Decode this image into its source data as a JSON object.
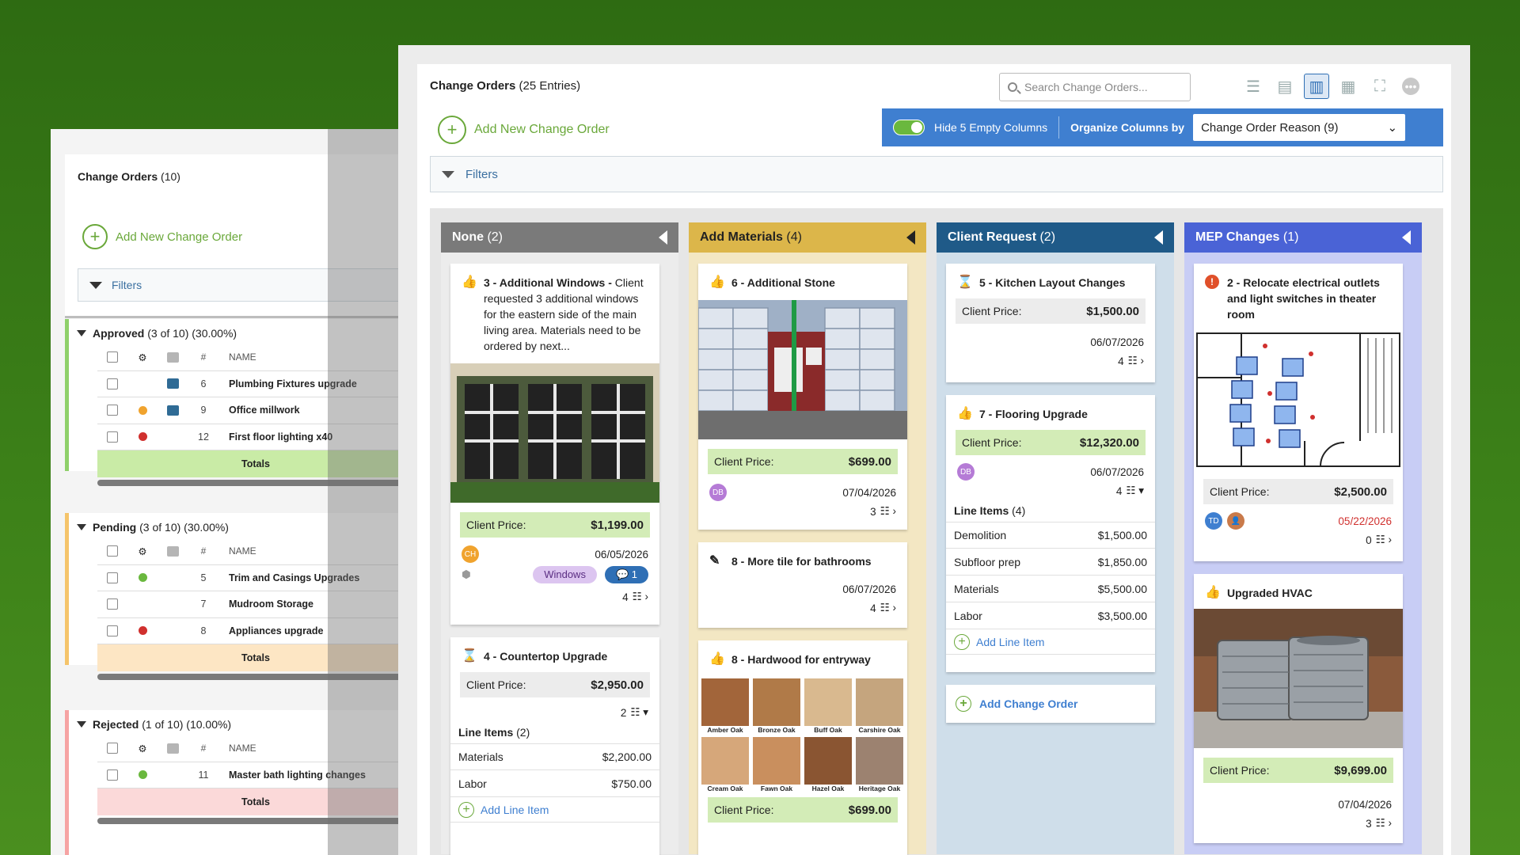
{
  "back": {
    "title": "Change Orders",
    "title_count": "(10)",
    "add_label": "Add New Change Order",
    "filters_label": "Filters",
    "col_hash": "#",
    "col_name": "NAME",
    "totals": "Totals",
    "groups": [
      {
        "name": "Approved",
        "stats": "(3 of 10) (30.00%)",
        "rows": [
          {
            "num": "6",
            "name": "Plumbing Fixtures upgrade"
          },
          {
            "num": "9",
            "name": "Office millwork"
          },
          {
            "num": "12",
            "name": "First floor lighting x40"
          }
        ]
      },
      {
        "name": "Pending",
        "stats": "(3 of 10) (30.00%)",
        "rows": [
          {
            "num": "5",
            "name": "Trim and Casings Upgrades"
          },
          {
            "num": "7",
            "name": "Mudroom Storage"
          },
          {
            "num": "8",
            "name": "Appliances upgrade"
          }
        ]
      },
      {
        "name": "Rejected",
        "stats": "(1 of 10) (10.00%)",
        "rows": [
          {
            "num": "11",
            "name": "Master bath lighting changes"
          }
        ]
      }
    ]
  },
  "main": {
    "title": "Change Orders",
    "title_count": "(25 Entries)",
    "search_placeholder": "Search Change Orders...",
    "add_label": "Add New Change Order",
    "toggle_label": "Hide 5 Empty Columns",
    "organize_label": "Organize Columns by",
    "organize_value": "Change Order Reason (9)",
    "filters_label": "Filters"
  },
  "columns": [
    {
      "name": "None",
      "count": "(2)",
      "color": "#7a7a7a",
      "body": "#ececec"
    },
    {
      "name": "Add Materials",
      "count": "(4)",
      "color": "#dcb64a",
      "body": "#f3e7c3"
    },
    {
      "name": "Client Request",
      "count": "(2)",
      "color": "#1f5a88",
      "body": "#cfdeea"
    },
    {
      "name": "MEP Changes",
      "count": "(1)",
      "color": "#4a63d6",
      "body": "#c8cdf5"
    }
  ],
  "cards": {
    "c3": {
      "title": "3 - Additional Windows -",
      "desc": "Client requested 3 additional windows for the eastern side of the main living area. Materials need to be ordered by next...",
      "price_label": "Client Price:",
      "price": "$1,199.00",
      "avatar": "CH",
      "date": "06/05/2026",
      "tag": "Windows",
      "comments": "1",
      "items": "4"
    },
    "c4": {
      "title": "4 - Countertop Upgrade",
      "price_label": "Client Price:",
      "price": "$2,950.00",
      "items": "2",
      "li_header": "Line Items",
      "li_count": "(2)",
      "lines": [
        {
          "n": "Materials",
          "v": "$2,200.00"
        },
        {
          "n": "Labor",
          "v": "$750.00"
        }
      ],
      "add_li": "Add Line Item"
    },
    "c6": {
      "title": "6 - Additional Stone",
      "price_label": "Client Price:",
      "price": "$699.00",
      "avatar": "DB",
      "date": "07/04/2026",
      "items": "3"
    },
    "c8a": {
      "title": "8 - More tile for bathrooms",
      "date": "06/07/2026",
      "items": "4"
    },
    "c8b": {
      "title": "8 - Hardwood for entryway",
      "price_label": "Client Price:",
      "price": "$699.00",
      "woods": [
        "Amber Oak",
        "Bronze Oak",
        "Buff Oak",
        "Carshire Oak",
        "Cream Oak",
        "Fawn Oak",
        "Hazel Oak",
        "Heritage Oak"
      ]
    },
    "c5": {
      "title": "5 - Kitchen Layout Changes",
      "price_label": "Client Price:",
      "price": "$1,500.00",
      "date": "06/07/2026",
      "items": "4"
    },
    "c7": {
      "title": "7 - Flooring Upgrade",
      "price_label": "Client Price:",
      "price": "$12,320.00",
      "avatar": "DB",
      "date": "06/07/2026",
      "items": "4",
      "li_header": "Line Items",
      "li_count": "(4)",
      "lines": [
        {
          "n": "Demolition",
          "v": "$1,500.00"
        },
        {
          "n": "Subfloor prep",
          "v": "$1,850.00"
        },
        {
          "n": "Materials",
          "v": "$5,500.00"
        },
        {
          "n": "Labor",
          "v": "$3,500.00"
        }
      ],
      "add_li": "Add Line Item"
    },
    "add_co": "Add Change Order",
    "c2": {
      "title": "2 - Relocate electrical outlets and light switches in theater room",
      "price_label": "Client Price:",
      "price": "$2,500.00",
      "avatar": "TD",
      "date": "05/22/2026",
      "items": "0"
    },
    "chvac": {
      "title": "Upgraded HVAC",
      "price_label": "Client Price:",
      "price": "$9,699.00",
      "date": "07/04/2026",
      "items": "3"
    }
  }
}
